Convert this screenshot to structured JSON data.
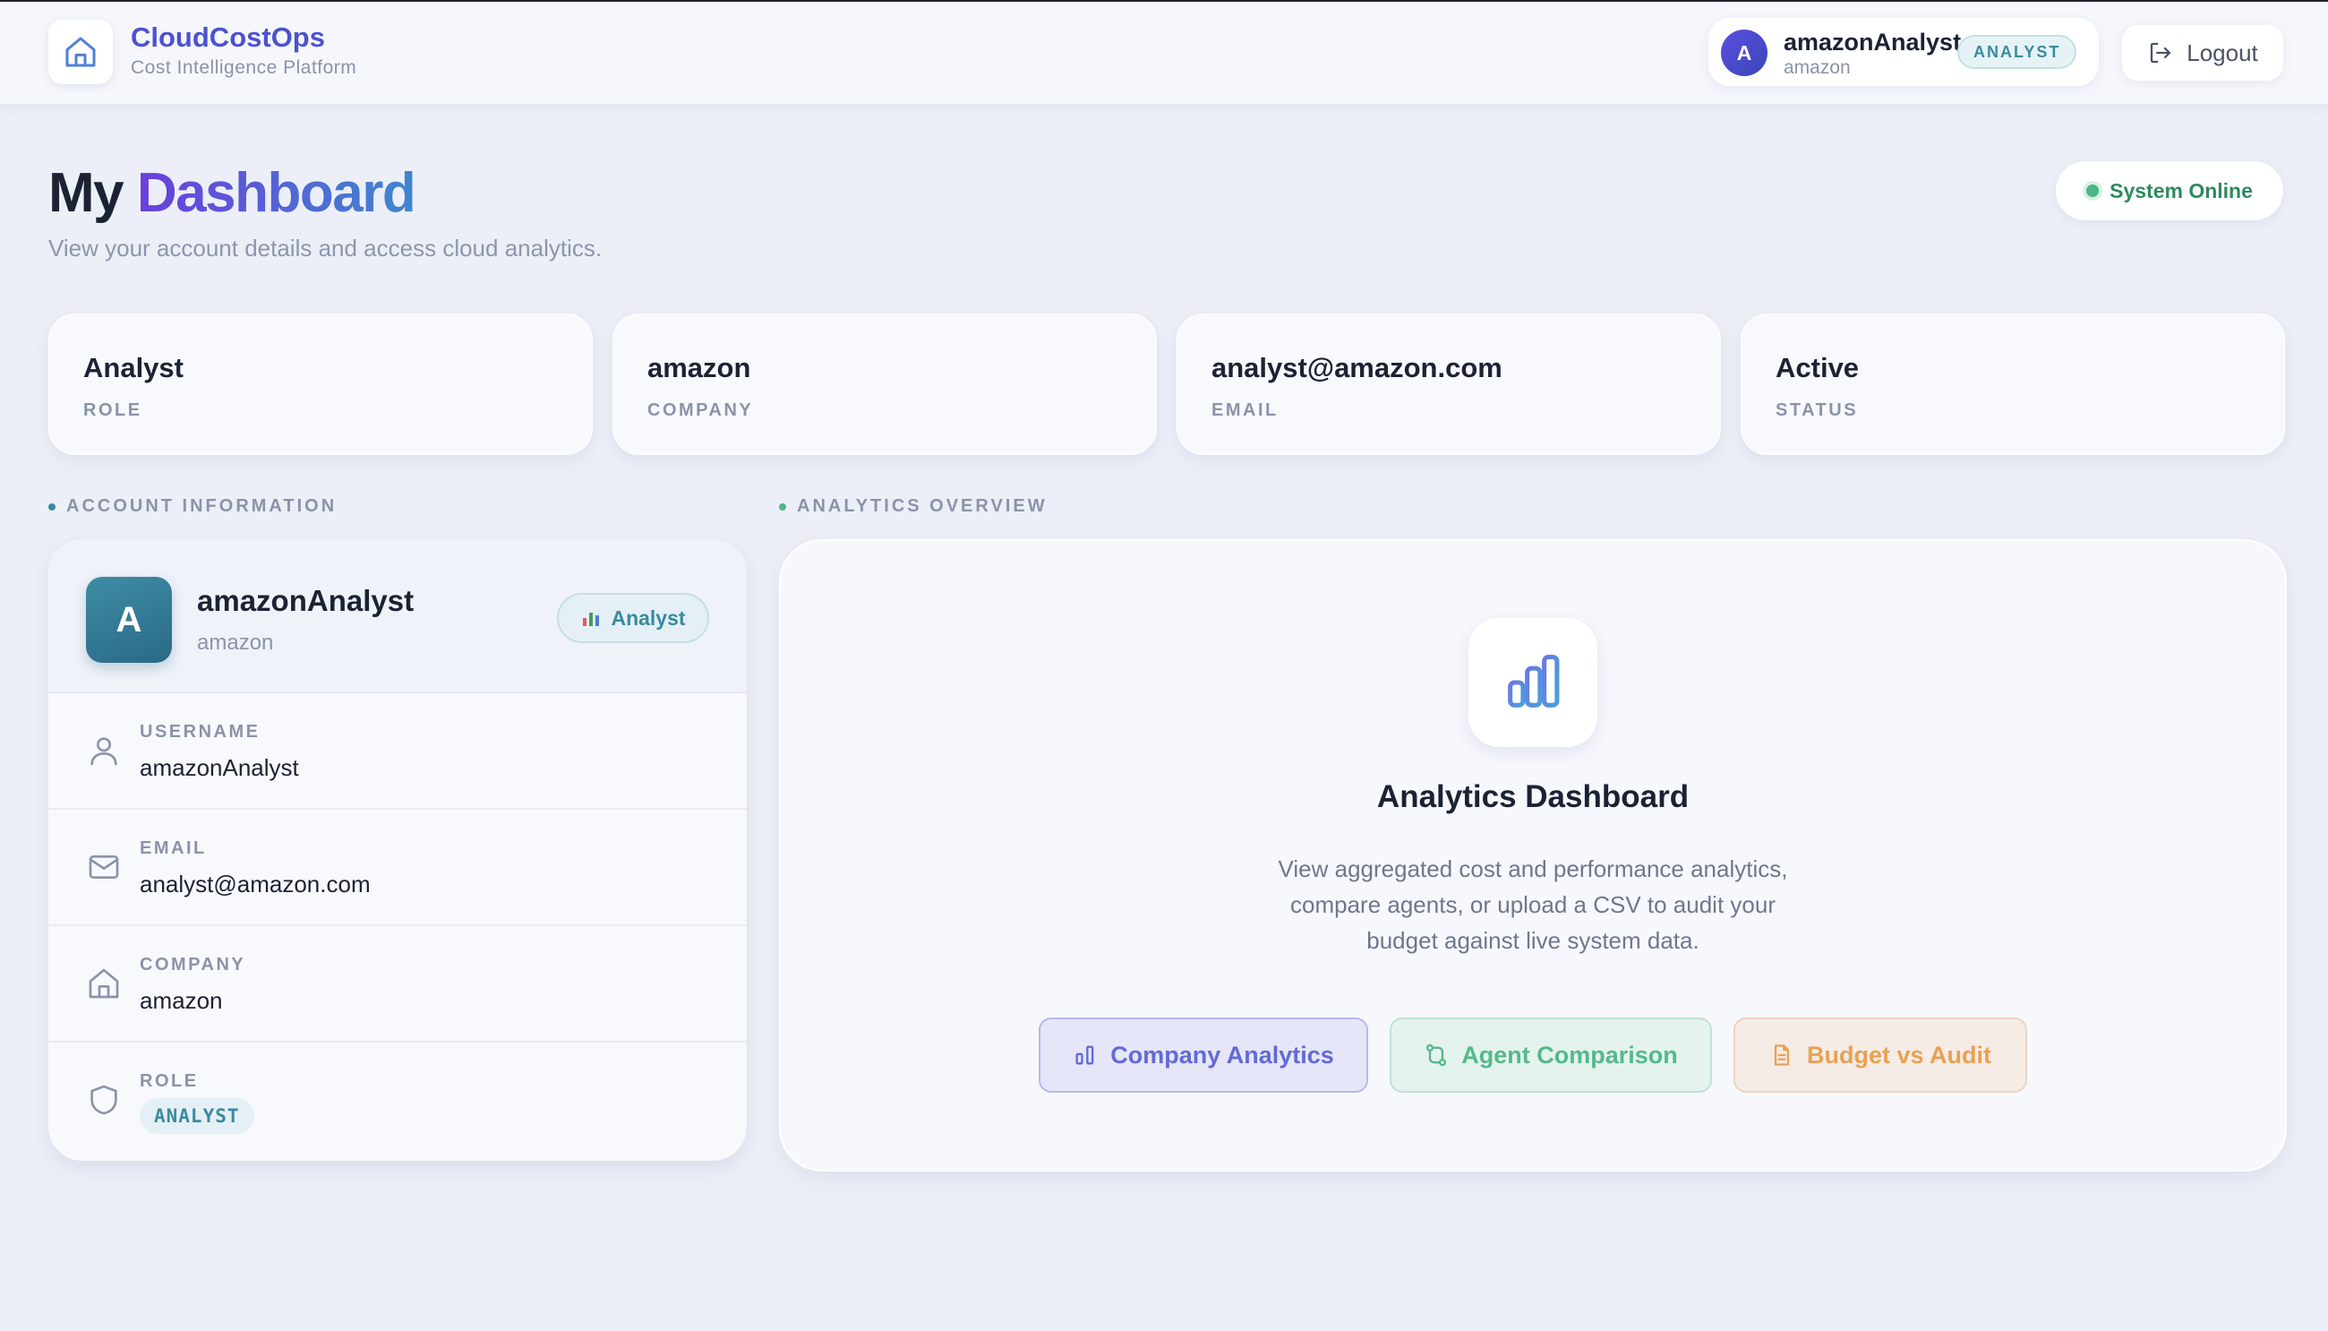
{
  "header": {
    "brand_name": "CloudCostOps",
    "brand_tagline": "Cost Intelligence Platform",
    "user": {
      "initial": "A",
      "name": "amazonAnalyst",
      "company": "amazon",
      "role_badge": "ANALYST"
    },
    "logout_label": "Logout"
  },
  "page": {
    "title_part1": "My",
    "title_part2": "Dashboard",
    "subtitle": "View your account details and access cloud analytics.",
    "status": "System Online"
  },
  "stats": [
    {
      "value": "Analyst",
      "label": "ROLE"
    },
    {
      "value": "amazon",
      "label": "COMPANY"
    },
    {
      "value": "analyst@amazon.com",
      "label": "EMAIL"
    },
    {
      "value": "Active",
      "label": "STATUS"
    }
  ],
  "account": {
    "section_title": "ACCOUNT INFORMATION",
    "initial": "A",
    "name": "amazonAnalyst",
    "company": "amazon",
    "badge": "Analyst",
    "rows": [
      {
        "label": "USERNAME",
        "value": "amazonAnalyst",
        "icon": "user-icon"
      },
      {
        "label": "EMAIL",
        "value": "analyst@amazon.com",
        "icon": "mail-icon"
      },
      {
        "label": "COMPANY",
        "value": "amazon",
        "icon": "building-icon"
      },
      {
        "label": "ROLE",
        "value": "ANALYST",
        "icon": "shield-icon"
      }
    ]
  },
  "analytics": {
    "section_title": "ANALYTICS OVERVIEW",
    "title": "Analytics Dashboard",
    "description": "View aggregated cost and performance analytics, compare agents, or upload a CSV to audit your budget against live system data.",
    "buttons": [
      {
        "label": "Company Analytics",
        "icon": "bar-chart-icon"
      },
      {
        "label": "Agent Comparison",
        "icon": "compare-icon"
      },
      {
        "label": "Budget vs Audit",
        "icon": "document-icon"
      }
    ]
  },
  "colors": {
    "brand": "#4d52cf",
    "accent_teal": "#3a8aa0",
    "online_green": "#48b783",
    "btn_company": "#6469d6",
    "btn_agent": "#54b98b",
    "btn_budget": "#e9a154"
  }
}
